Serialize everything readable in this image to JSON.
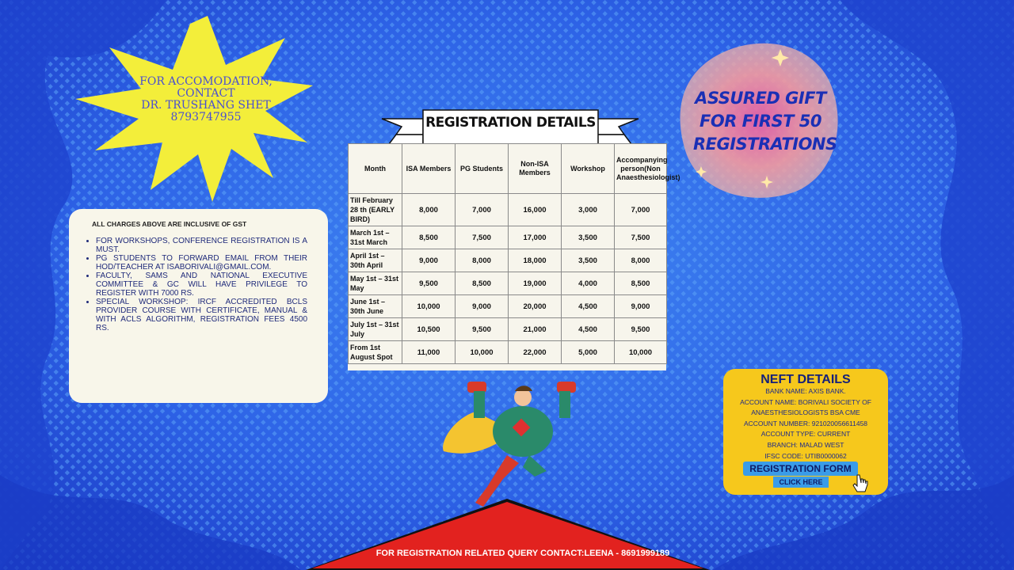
{
  "accommodation": {
    "line1": "FOR ACCOMODATION,",
    "line2": "CONTACT",
    "line3": "DR. TRUSHANG SHET",
    "line4": "8793747955"
  },
  "gift": {
    "line1": "ASSURED GIFT",
    "line2": "FOR FIRST 50",
    "line3": "REGISTRATIONS"
  },
  "registration": {
    "title": "REGISTRATION DETAILS",
    "headers": [
      "Month",
      "ISA Members",
      "PG Students",
      "Non-ISA Members",
      "Workshop",
      "Accompanying person(Non Anaesthesiologist)"
    ],
    "rows": [
      {
        "month": "Till February 28 th (EARLY BIRD)",
        "isa": "8,000",
        "pg": "7,000",
        "non_isa": "16,000",
        "workshop": "3,000",
        "accompanying": "7,000"
      },
      {
        "month": "March 1st – 31st March",
        "isa": "8,500",
        "pg": "7,500",
        "non_isa": "17,000",
        "workshop": "3,500",
        "accompanying": "7,500"
      },
      {
        "month": "April 1st – 30th April",
        "isa": "9,000",
        "pg": "8,000",
        "non_isa": "18,000",
        "workshop": "3,500",
        "accompanying": "8,000"
      },
      {
        "month": "May 1st – 31st May",
        "isa": "9,500",
        "pg": "8,500",
        "non_isa": "19,000",
        "workshop": "4,000",
        "accompanying": "8,500"
      },
      {
        "month": "June 1st – 30th June",
        "isa": "10,000",
        "pg": "9,000",
        "non_isa": "20,000",
        "workshop": "4,500",
        "accompanying": "9,000"
      },
      {
        "month": "July 1st – 31st July",
        "isa": "10,500",
        "pg": "9,500",
        "non_isa": "21,000",
        "workshop": "4,500",
        "accompanying": "9,500"
      },
      {
        "month": "From 1st August Spot",
        "isa": "11,000",
        "pg": "10,000",
        "non_isa": "22,000",
        "workshop": "5,000",
        "accompanying": "10,000"
      }
    ]
  },
  "charges": {
    "heading": "ALL CHARGES ABOVE ARE INCLUSIVE OF GST",
    "items": [
      "FOR WORKSHOPS, CONFERENCE REGISTRATION IS A MUST.",
      "PG STUDENTS TO FORWARD EMAIL FROM THEIR HOD/TEACHER AT ISABORIVALI@GMAIL.COM.",
      "FACULTY, SAMS AND NATIONAL EXECUTIVE COMMITTEE & GC WILL HAVE PRIVILEGE TO REGISTER WITH 7000 RS.",
      "SPECIAL WORKSHOP: IRCF ACCREDITED BCLS PROVIDER COURSE WITH CERTIFICATE, MANUAL & WITH ACLS ALGORITHM, REGISTRATION FEES 4500 RS."
    ]
  },
  "neft": {
    "title": "NEFT DETAILS",
    "bank_name": "BANK NAME: AXIS BANK.",
    "account_name_1": "ACCOUNT NAME: BORIVALI SOCIETY OF",
    "account_name_2": "ANAESTHESIOLOGISTS BSA CME",
    "account_number": "ACCOUNT NUMBER: 921020056611458",
    "account_type": "ACCOUNT TYPE: CURRENT",
    "branch": "BRANCH: MALAD WEST",
    "ifsc": "IFSC CODE: UTIB0000062",
    "form_button": "REGISTRATION FORM",
    "click_here": "CLICK HERE"
  },
  "footer": {
    "query": "FOR REGISTRATION RELATED QUERY CONTACT:LEENA - 8691999189"
  },
  "colors": {
    "background": "#2a5fe6",
    "starburst": "#f3ee3a",
    "neft_card": "#f6c81c",
    "footer_triangle": "#e2221f",
    "gift_blob": "#f7a6a0"
  },
  "icons": [
    "superhero-illustration",
    "cursor-icon",
    "sparkle-icon"
  ]
}
